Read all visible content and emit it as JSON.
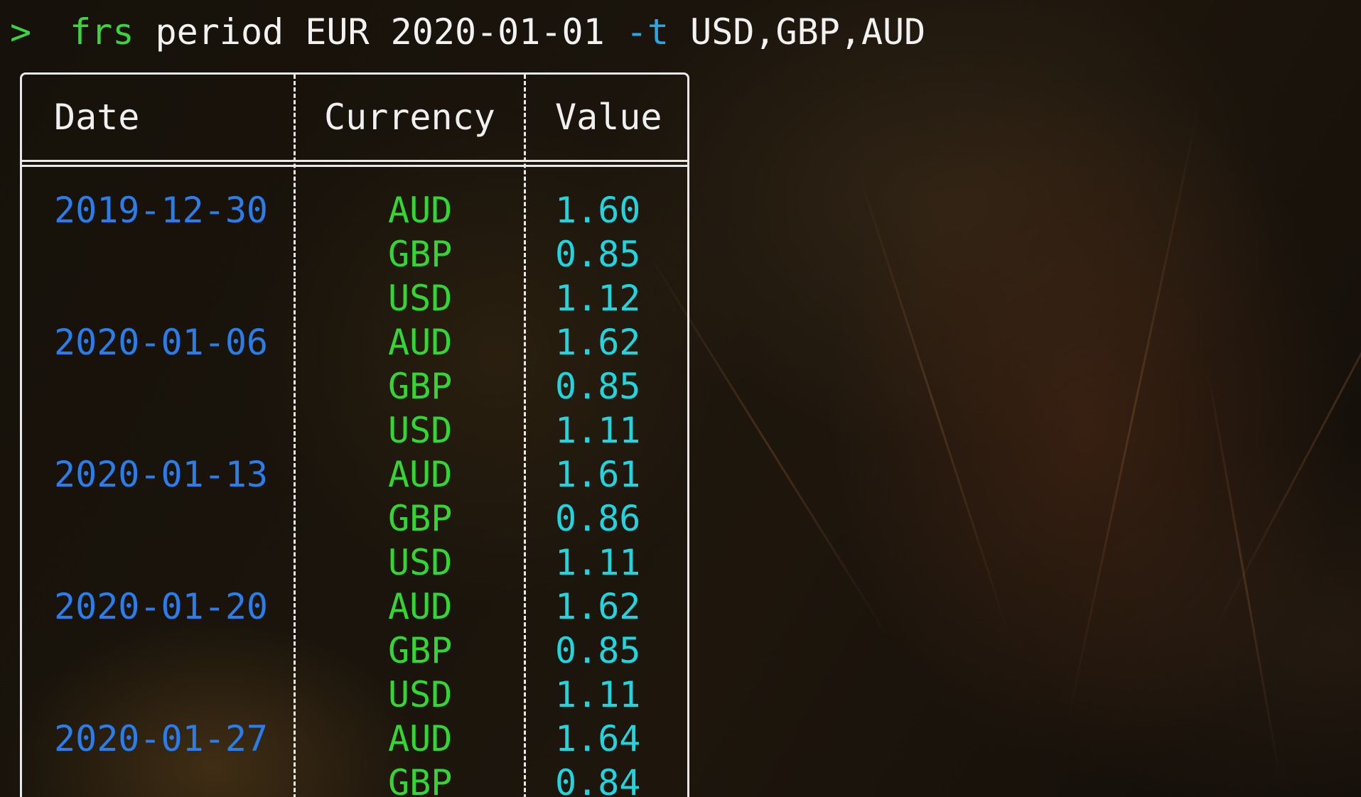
{
  "terminal": {
    "prompt_symbol": ">",
    "command": "frs",
    "args": "period EUR 2020-01-01",
    "flag": "-t",
    "flag_value": "USD,GBP,AUD"
  },
  "table": {
    "headers": [
      "Date",
      "Currency",
      "Value"
    ],
    "rows": [
      {
        "date": "2019-12-30",
        "currency": "AUD",
        "value": "1.60"
      },
      {
        "date": "",
        "currency": "GBP",
        "value": "0.85"
      },
      {
        "date": "",
        "currency": "USD",
        "value": "1.12"
      },
      {
        "date": "2020-01-06",
        "currency": "AUD",
        "value": "1.62"
      },
      {
        "date": "",
        "currency": "GBP",
        "value": "0.85"
      },
      {
        "date": "",
        "currency": "USD",
        "value": "1.11"
      },
      {
        "date": "2020-01-13",
        "currency": "AUD",
        "value": "1.61"
      },
      {
        "date": "",
        "currency": "GBP",
        "value": "0.86"
      },
      {
        "date": "",
        "currency": "USD",
        "value": "1.11"
      },
      {
        "date": "2020-01-20",
        "currency": "AUD",
        "value": "1.62"
      },
      {
        "date": "",
        "currency": "GBP",
        "value": "0.85"
      },
      {
        "date": "",
        "currency": "USD",
        "value": "1.11"
      },
      {
        "date": "2020-01-27",
        "currency": "AUD",
        "value": "1.64"
      },
      {
        "date": "",
        "currency": "GBP",
        "value": "0.84"
      }
    ]
  },
  "colors": {
    "prompt": "#3fd33f",
    "flag": "#27a7e6",
    "date": "#2b7de9",
    "currency": "#33d633",
    "value": "#1fd6e0",
    "border": "#e8e8e8"
  }
}
